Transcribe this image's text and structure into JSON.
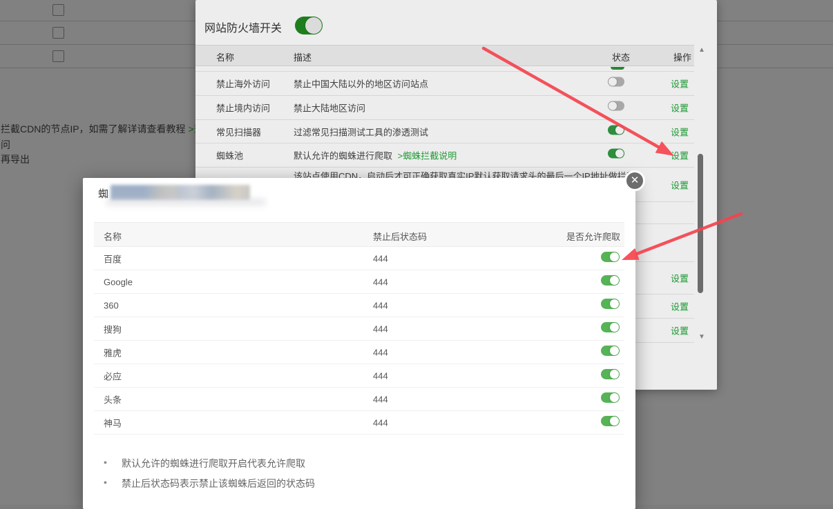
{
  "background_page": {
    "cdn_note": "拦截CDN的节点IP，如需了解详请查看教程",
    "cdn_note_link": ">查看教程",
    "line2": "问",
    "line3": "再导出",
    "checkbox_rows": 3
  },
  "firewall": {
    "title": "网站防火墙开关",
    "master_toggle": "on",
    "columns": [
      "名称",
      "描述",
      "状态",
      "操作"
    ],
    "rows": [
      {
        "name": "禁止海外访问",
        "desc": "禁止中国大陆以外的地区访问站点",
        "toggle": "off",
        "action": "设置"
      },
      {
        "name": "禁止境内访问",
        "desc": "禁止大陆地区访问",
        "toggle": "off",
        "action": "设置"
      },
      {
        "name": "常见扫描器",
        "desc": "过滤常见扫描测试工具的渗透测试",
        "toggle": "on",
        "action": "设置"
      },
      {
        "name": "蜘蛛池",
        "desc": "默认允许的蜘蛛进行爬取",
        "desc_link": ">蜘蛛拦截说明",
        "toggle": "on",
        "action": "设置"
      },
      {
        "name": "",
        "desc": "该站点使用CDN，启动后才可正确获取真实IP默认获取请求头的最后一个IP地址做拦截",
        "toggle": "",
        "action": "设置"
      }
    ],
    "behind_modal_rows": [
      {
        "action": ""
      },
      {
        "action": ""
      },
      {
        "action": "设置"
      },
      {
        "action": "设置"
      },
      {
        "action": "设置"
      }
    ],
    "icons": {
      "scroll_up": "▲",
      "scroll_down": "▼"
    }
  },
  "modal": {
    "title_prefix": "蜘",
    "columns": [
      "名称",
      "禁止后状态码",
      "是否允许爬取"
    ],
    "spiders": [
      {
        "name": "百度",
        "code": "444",
        "allowed": "on"
      },
      {
        "name": "Google",
        "code": "444",
        "allowed": "on"
      },
      {
        "name": "360",
        "code": "444",
        "allowed": "on"
      },
      {
        "name": "搜狗",
        "code": "444",
        "allowed": "on"
      },
      {
        "name": "雅虎",
        "code": "444",
        "allowed": "on"
      },
      {
        "name": "必应",
        "code": "444",
        "allowed": "on"
      },
      {
        "name": "头条",
        "code": "444",
        "allowed": "on"
      },
      {
        "name": "神马",
        "code": "444",
        "allowed": "on"
      }
    ],
    "notes": [
      "默认允许的蜘蛛进行爬取开启代表允许爬取",
      "禁止后状态码表示禁止该蜘蛛后返回的状态码"
    ],
    "close_glyph": "✕"
  },
  "colors": {
    "accent_green": "#20a53a",
    "toggle_on_modal": "#56b356",
    "toggle_on_panel": "#319a43",
    "toggle_off": "#b5b5b5",
    "arrow_red": "#f5444f"
  }
}
